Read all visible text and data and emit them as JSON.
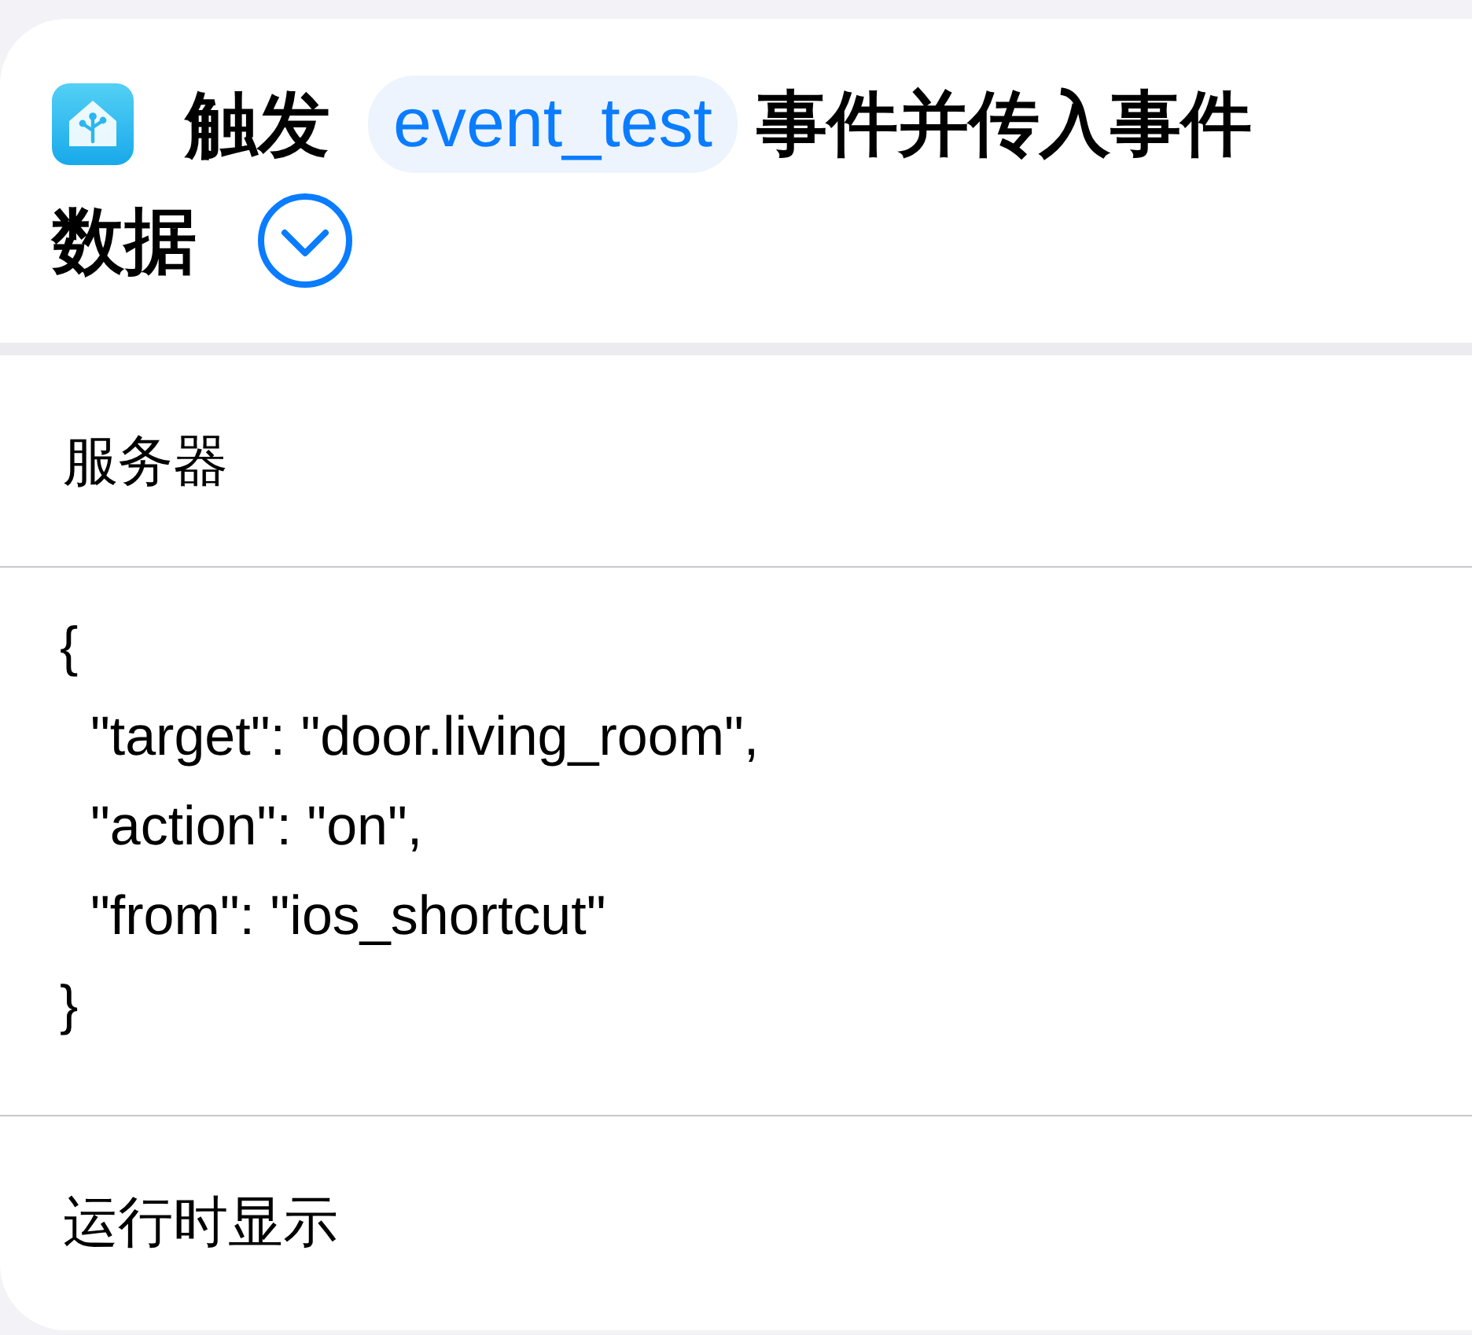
{
  "action": {
    "verb": "触发",
    "token": "event_test",
    "rest": "事件并传入事件",
    "rest_line2": "数据"
  },
  "rows": [
    {
      "kind": "label",
      "text": "服务器"
    },
    {
      "kind": "code",
      "text": "{\n  \"target\": \"door.living_room\",\n  \"action\": \"on\",\n  \"from\": \"ios_shortcut\"\n}"
    },
    {
      "kind": "label",
      "text": "运行时显示"
    }
  ]
}
